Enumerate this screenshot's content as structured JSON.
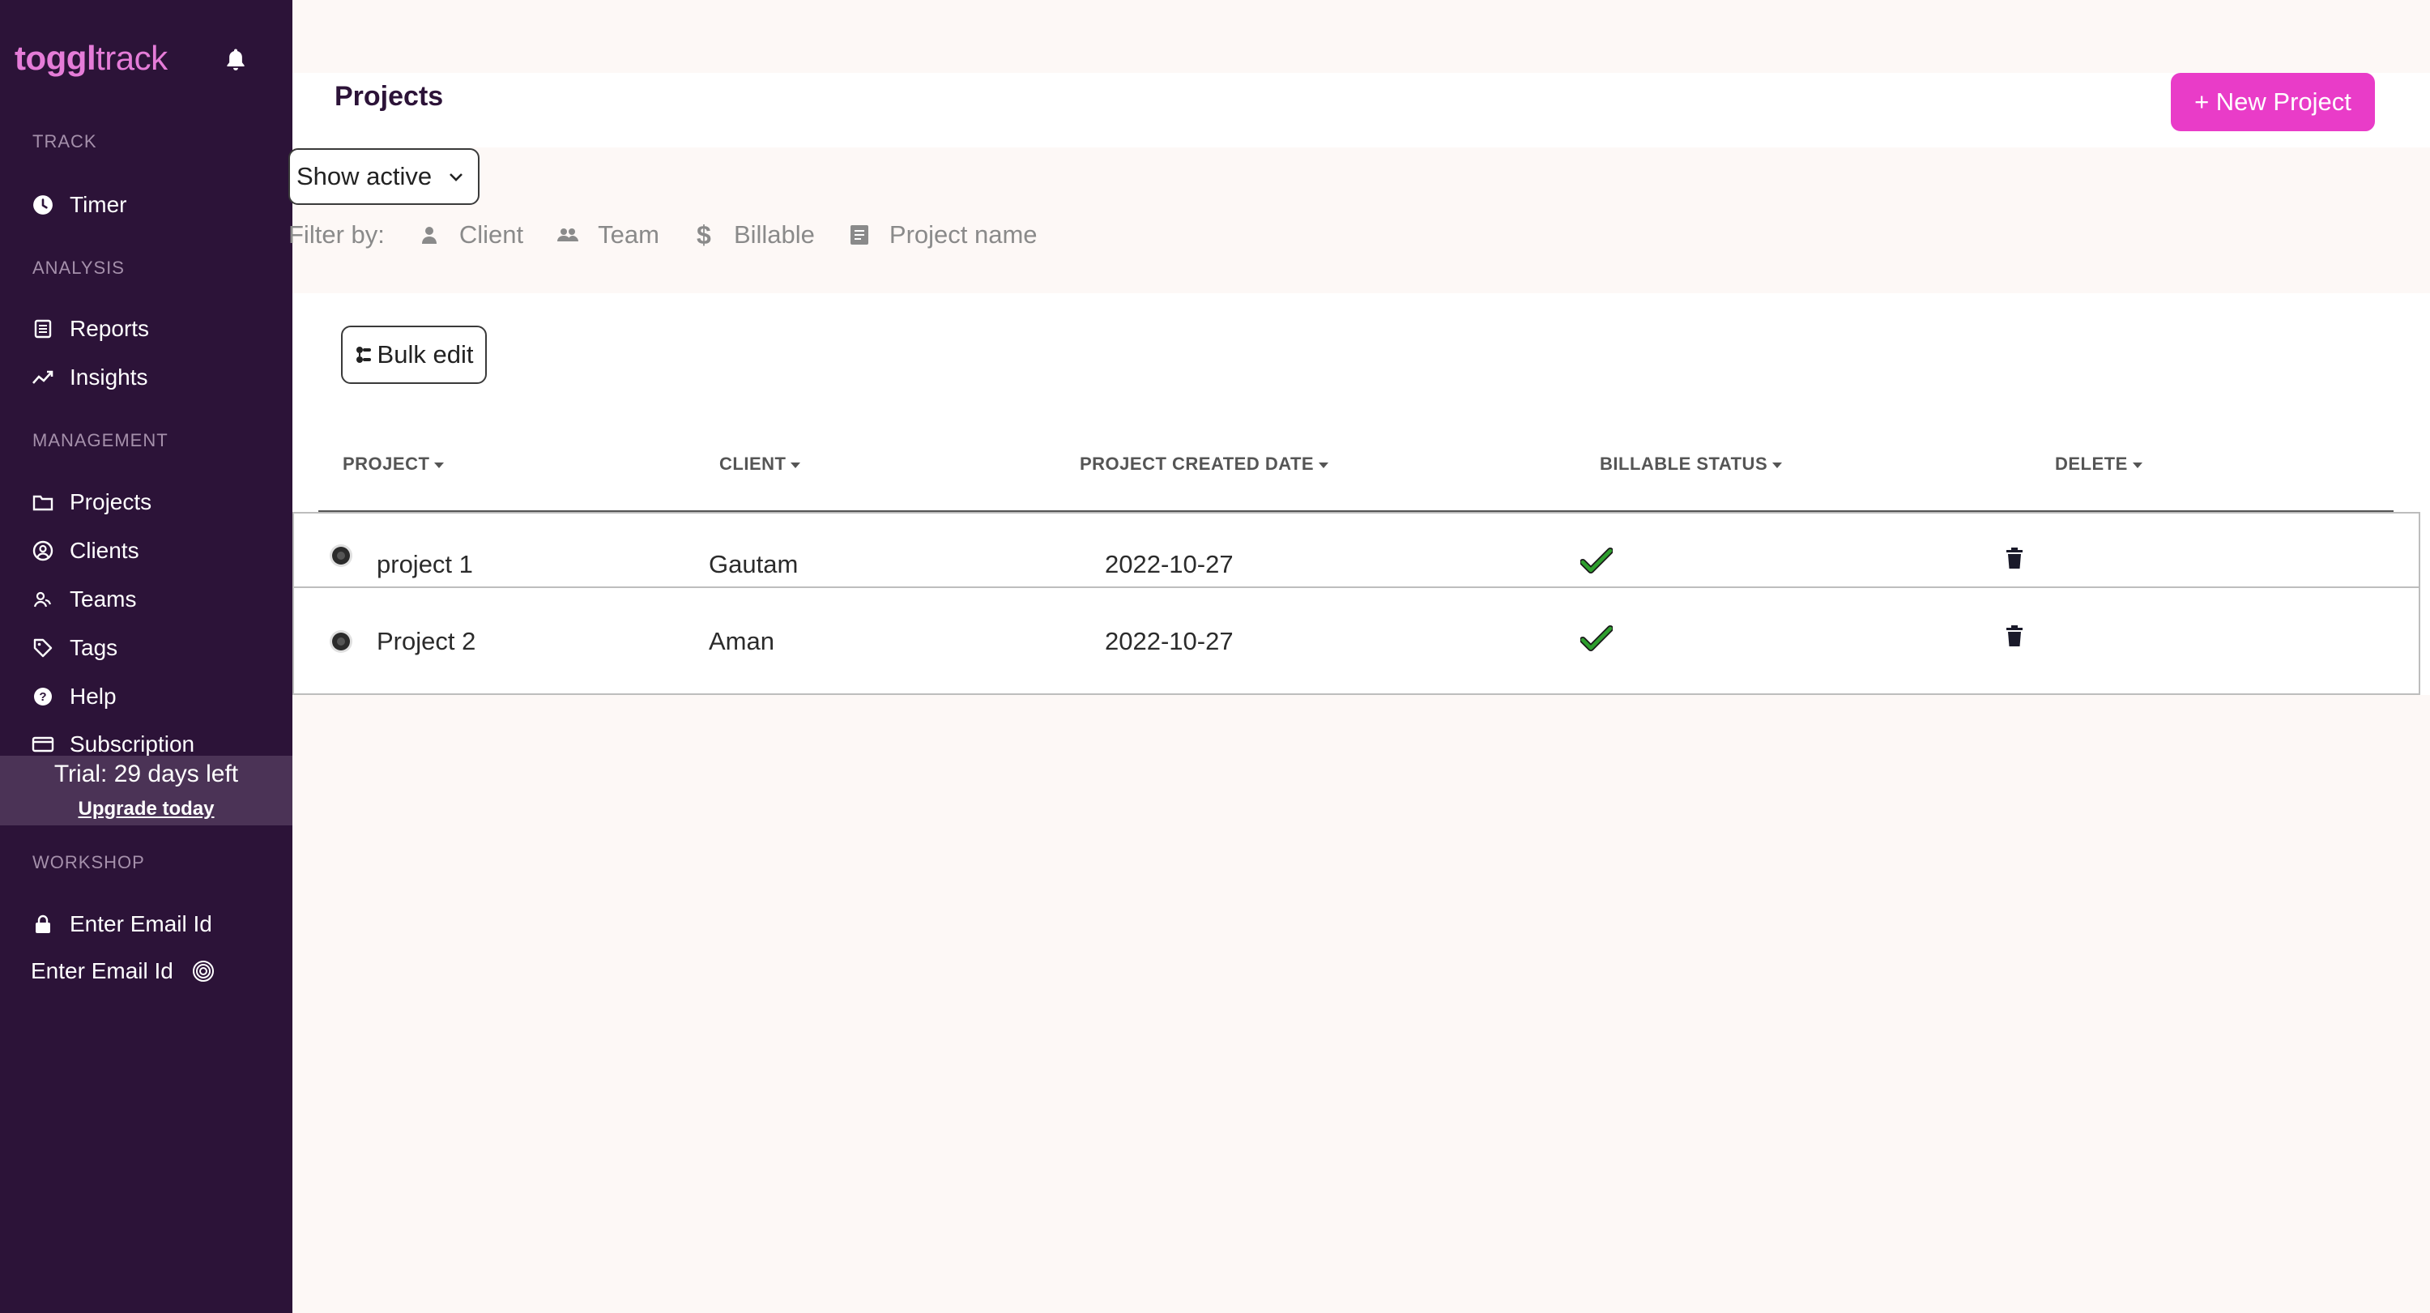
{
  "brand": {
    "logo_bold": "toggl",
    "logo_light": "track"
  },
  "sidebar": {
    "sections": {
      "track": "TRACK",
      "analysis": "ANALYSIS",
      "management": "MANAGEMENT",
      "workshop": "WORKSHOP"
    },
    "items": {
      "timer": "Timer",
      "reports": "Reports",
      "insights": "Insights",
      "projects": "Projects",
      "clients": "Clients",
      "teams": "Teams",
      "tags": "Tags",
      "help": "Help",
      "subscription": "Subscription",
      "workshop_email": "Enter Email Id",
      "email_plain": "Enter Email Id"
    },
    "trial": {
      "text": "Trial: 29 days left",
      "upgrade": "Upgrade today"
    }
  },
  "header": {
    "title": "Projects",
    "new_project": "+ New Project"
  },
  "filters": {
    "status_select": "Show active",
    "label": "Filter by:",
    "client": "Client",
    "team": "Team",
    "billable": "Billable",
    "project_name": "Project name"
  },
  "toolbar": {
    "bulk_edit": "Bulk edit"
  },
  "table": {
    "columns": {
      "project": "PROJECT",
      "client": "CLIENT",
      "created": "PROJECT CREATED DATE",
      "billable": "BILLABLE STATUS",
      "delete": "DELETE"
    },
    "rows": [
      {
        "project": "project 1",
        "client": "Gautam",
        "created": "2022-10-27",
        "billable": true
      },
      {
        "project": "Project 2",
        "client": "Aman",
        "created": "2022-10-27",
        "billable": true
      }
    ]
  },
  "colors": {
    "sidebar_bg": "#2c1338",
    "accent": "#e93cc8",
    "logo": "#e57cd8",
    "check": "#2e9e2e"
  }
}
